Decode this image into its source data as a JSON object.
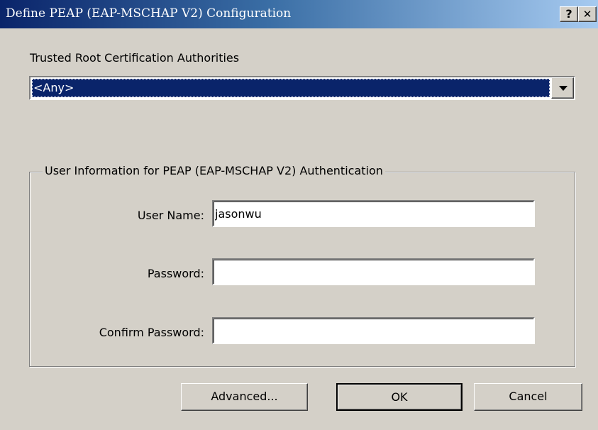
{
  "window": {
    "title": "Define PEAP (EAP-MSCHAP V2) Configuration",
    "help_label": "?",
    "close_label": "✕"
  },
  "trusted_root": {
    "label": "Trusted Root Certification Authorities",
    "selected": "<Any>"
  },
  "user_info": {
    "group_title": "User Information for PEAP (EAP-MSCHAP V2) Authentication",
    "username_label": "User Name:",
    "username_value": "jasonwu",
    "password_label": "Password:",
    "password_value": "",
    "confirm_label": "Confirm Password:",
    "confirm_value": ""
  },
  "buttons": {
    "advanced": "Advanced...",
    "ok": "OK",
    "cancel": "Cancel"
  },
  "colors": {
    "title_start": "#0a246a",
    "title_end": "#a6caf0",
    "selection": "#0a246a",
    "face": "#d4d0c8"
  },
  "icons": {
    "help": "help-icon",
    "close": "close-icon",
    "dropdown": "chevron-down-icon"
  }
}
